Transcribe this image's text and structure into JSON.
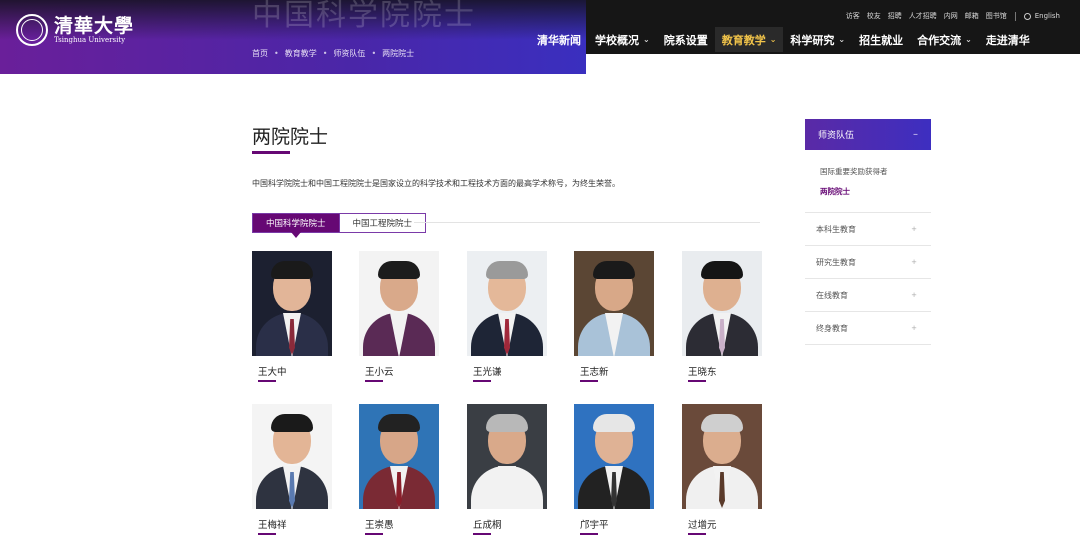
{
  "header": {
    "ghost_title": "中国科学院院士",
    "logo_cn": "清華大學",
    "logo_en": "Tsinghua University",
    "breadcrumb": [
      "首页",
      "教育教学",
      "师资队伍",
      "两院院士"
    ],
    "utility_links": [
      "访客",
      "校友",
      "招聘",
      "人才招聘",
      "内网",
      "邮箱",
      "图书馆"
    ],
    "language": "English",
    "nav": [
      {
        "label": "清华新闻",
        "chevron": false,
        "active": false
      },
      {
        "label": "学校概况",
        "chevron": true,
        "active": false
      },
      {
        "label": "院系设置",
        "chevron": false,
        "active": false
      },
      {
        "label": "教育教学",
        "chevron": true,
        "active": true
      },
      {
        "label": "科学研究",
        "chevron": true,
        "active": false
      },
      {
        "label": "招生就业",
        "chevron": false,
        "active": false
      },
      {
        "label": "合作交流",
        "chevron": true,
        "active": false
      },
      {
        "label": "走进清华",
        "chevron": false,
        "active": false
      }
    ],
    "active_color": "#f0c34a",
    "banner_color": "#5a26a6"
  },
  "main": {
    "title": "两院院士",
    "intro": "中国科学院院士和中国工程院院士是国家设立的科学技术和工程技术方面的最高学术称号，为终生荣誉。",
    "tabs": [
      {
        "label": "中国科学院院士",
        "active": true
      },
      {
        "label": "中国工程院院士",
        "active": false
      }
    ],
    "members": [
      {
        "name": "王大中",
        "bg": "#1c2030",
        "skin": "#e2b598",
        "hair": "#1a1a1a",
        "suit": "#2a2f48",
        "tie": "#8a2a3a"
      },
      {
        "name": "王小云",
        "bg": "#f3f3f3",
        "skin": "#d9a98a",
        "hair": "#1c1c1c",
        "suit": "#5a2a55",
        "tie": ""
      },
      {
        "name": "王光谦",
        "bg": "#eceff2",
        "skin": "#e4b899",
        "hair": "#9a9a9a",
        "suit": "#1e2536",
        "tie": "#a0283a"
      },
      {
        "name": "王志新",
        "bg": "#5b4634",
        "skin": "#d8a888",
        "hair": "#1a1a1a",
        "suit": "#a9c2d8",
        "tie": ""
      },
      {
        "name": "王晓东",
        "bg": "#e9ecef",
        "skin": "#deb090",
        "hair": "#151515",
        "suit": "#2c2c34",
        "tie": "#c9b0c8"
      },
      {
        "name": "王梅祥",
        "bg": "#f4f4f4",
        "skin": "#e3b596",
        "hair": "#1a1a1a",
        "suit": "#2e3340",
        "tie": "#5a7ab0"
      },
      {
        "name": "王崇愚",
        "bg": "#2f74b6",
        "skin": "#d7a688",
        "hair": "#222",
        "suit": "#7a2a34",
        "tie": "#8a1e2a"
      },
      {
        "name": "丘成桐",
        "bg": "#3a3e44",
        "skin": "#d9a98a",
        "hair": "#b8b8b8",
        "suit": "#f2f2f2",
        "tie": ""
      },
      {
        "name": "邝宇平",
        "bg": "#2f72c0",
        "skin": "#dfb295",
        "hair": "#e6e6e6",
        "suit": "#222",
        "tie": "#333"
      },
      {
        "name": "过增元",
        "bg": "#6a4a3a",
        "skin": "#dbad8e",
        "hair": "#cfcfcf",
        "suit": "#f0f0f0",
        "tie": "#5a3a2a"
      }
    ]
  },
  "sidebar": {
    "heading": "师资队伍",
    "heading_icon": "minus-icon",
    "sub_items": [
      {
        "label": "国际重要奖励获得者",
        "current": false
      },
      {
        "label": "两院院士",
        "current": true
      }
    ],
    "items": [
      "本科生教育",
      "研究生教育",
      "在线教育",
      "终身教育"
    ],
    "accent": "#660874"
  }
}
